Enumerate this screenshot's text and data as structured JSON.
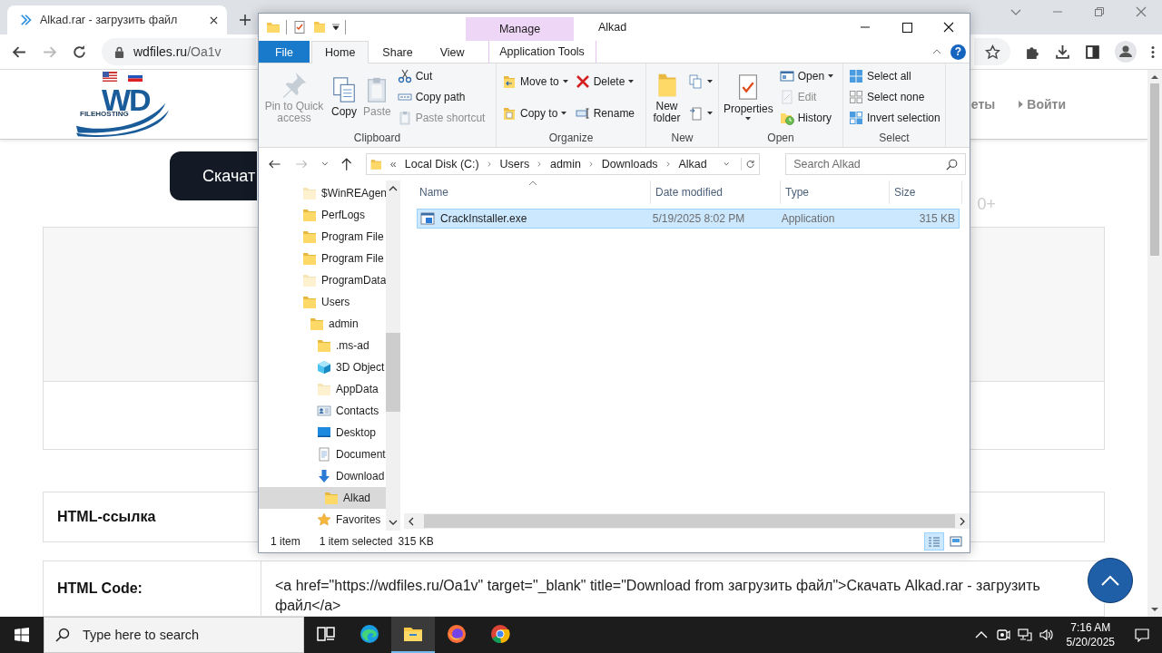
{
  "browser": {
    "tab": {
      "title": "Alkad.rar - загрузить файл"
    },
    "address": {
      "host": "wdfiles.ru",
      "path": "/Oa1v"
    },
    "site": {
      "logo": {
        "mark": "WD",
        "tagline": "FILEHOSTING"
      },
      "nav": [
        {
          "label": "еты"
        },
        {
          "label": "Войти"
        }
      ],
      "download_button": "Скачат",
      "counter": "0+",
      "info_rows": [
        {
          "label": "HTML-ссылка"
        },
        {
          "label": "HTML Code:",
          "value": "<a href=\"https://wdfiles.ru/Oa1v\" target=\"_blank\" title=\"Download from загрузить файл\">Скачать Alkad.rar - загрузить файл</a>"
        }
      ]
    }
  },
  "explorer": {
    "title": "Alkad",
    "context_tab": "Manage",
    "help": "?",
    "tabs": [
      {
        "label": "File",
        "kind": "file",
        "selected": false
      },
      {
        "label": "Home",
        "kind": "tab",
        "selected": true
      },
      {
        "label": "Share",
        "kind": "tab",
        "selected": false
      },
      {
        "label": "View",
        "kind": "tab",
        "selected": false
      },
      {
        "label": "Application Tools",
        "kind": "context",
        "selected": false
      }
    ],
    "ribbon": [
      {
        "name": "Clipboard",
        "columns": [
          [
            {
              "kind": "pin",
              "label": "Pin to Quick access",
              "disabled": true
            }
          ],
          [
            {
              "kind": "copy",
              "label": "Copy",
              "disabled": false
            }
          ],
          [
            {
              "kind": "paste",
              "label": "Paste",
              "disabled": true
            }
          ],
          [
            {
              "kind": "cut",
              "label": "Cut",
              "disabled": false
            },
            {
              "kind": "copypath",
              "label": "Copy path",
              "disabled": false
            },
            {
              "kind": "pasteshortcut",
              "label": "Paste shortcut",
              "disabled": true
            }
          ]
        ]
      },
      {
        "name": "Organize",
        "columns": [
          [
            {
              "kind": "moveto",
              "label": "Move to",
              "disabled": false,
              "dropdown": true
            },
            {
              "kind": "copyto",
              "label": "Copy to",
              "disabled": false,
              "dropdown": true
            }
          ],
          [
            {
              "kind": "delete",
              "label": "Delete",
              "disabled": false,
              "dropdown": true
            },
            {
              "kind": "rename",
              "label": "Rename",
              "disabled": false
            }
          ]
        ]
      },
      {
        "name": "New",
        "columns": [
          [
            {
              "kind": "newfolder",
              "label": "New folder",
              "disabled": false
            }
          ],
          [
            {
              "kind": "newitem",
              "disabled": false,
              "dropdown": true
            },
            {
              "kind": "easyaccess",
              "disabled": false,
              "dropdown": true
            }
          ]
        ]
      },
      {
        "name": "Open",
        "columns": [
          [
            {
              "kind": "properties",
              "label": "Properties",
              "disabled": false,
              "dropdown": true
            }
          ],
          [
            {
              "kind": "open",
              "label": "Open",
              "disabled": false,
              "dropdown": true
            },
            {
              "kind": "edit",
              "label": "Edit",
              "disabled": true
            },
            {
              "kind": "history",
              "label": "History",
              "disabled": false
            }
          ]
        ]
      },
      {
        "name": "Select",
        "columns": [
          [
            {
              "kind": "selectall",
              "label": "Select all",
              "disabled": false
            },
            {
              "kind": "selectnone",
              "label": "Select none",
              "disabled": false
            },
            {
              "kind": "invert",
              "label": "Invert selection",
              "disabled": false
            }
          ]
        ]
      }
    ],
    "address": {
      "overflow": "«",
      "path": [
        "Local Disk (C:)",
        "Users",
        "admin",
        "Downloads",
        "Alkad"
      ]
    },
    "search_placeholder": "Search Alkad",
    "nav": [
      {
        "label": "$WinREAgen",
        "kind": "hidden",
        "selected": false
      },
      {
        "label": "PerfLogs",
        "kind": "folder",
        "selected": false
      },
      {
        "label": "Program File",
        "kind": "folder",
        "selected": false
      },
      {
        "label": "Program File",
        "kind": "folder",
        "selected": false
      },
      {
        "label": "ProgramData",
        "kind": "hidden",
        "selected": false
      },
      {
        "label": "Users",
        "kind": "folder",
        "selected": false,
        "children": [
          {
            "label": "admin",
            "kind": "folder",
            "selected": false,
            "children": [
              {
                "label": ".ms-ad",
                "kind": "folder",
                "selected": false
              },
              {
                "label": "3D Object",
                "kind": "cube",
                "selected": false
              },
              {
                "label": "AppData",
                "kind": "hidden",
                "selected": false
              },
              {
                "label": "Contacts",
                "kind": "contacts",
                "selected": false
              },
              {
                "label": "Desktop",
                "kind": "desktop",
                "selected": false
              },
              {
                "label": "Document",
                "kind": "documents",
                "selected": false
              },
              {
                "label": "Download",
                "kind": "downloads",
                "selected": false,
                "children": [
                  {
                    "label": "Alkad",
                    "kind": "folder",
                    "selected": true
                  }
                ]
              },
              {
                "label": "Favorites",
                "kind": "star",
                "selected": false
              }
            ]
          }
        ]
      }
    ],
    "columns": [
      {
        "label": "Name",
        "sorted": true
      },
      {
        "label": "Date modified",
        "sorted": false
      },
      {
        "label": "Type",
        "sorted": false
      },
      {
        "label": "Size",
        "sorted": false
      }
    ],
    "files": [
      {
        "name": "CrackInstaller.exe",
        "date": "5/19/2025 8:02 PM",
        "type": "Application",
        "size": "315 KB",
        "selected": true
      }
    ],
    "status": {
      "count": "1 item",
      "selection": "1 item selected",
      "size": "315 KB"
    },
    "views": [
      {
        "kind": "details",
        "selected": true
      },
      {
        "kind": "largeicons",
        "selected": false
      }
    ]
  },
  "taskbar": {
    "search_placeholder": "Type here to search",
    "apps": [
      {
        "kind": "taskview",
        "selected": false
      },
      {
        "kind": "edge",
        "selected": false
      },
      {
        "kind": "explorer",
        "selected": true
      },
      {
        "kind": "firefox",
        "selected": false
      },
      {
        "kind": "chrome",
        "selected": false
      }
    ],
    "time": "7:16 AM",
    "date": "5/20/2025"
  }
}
